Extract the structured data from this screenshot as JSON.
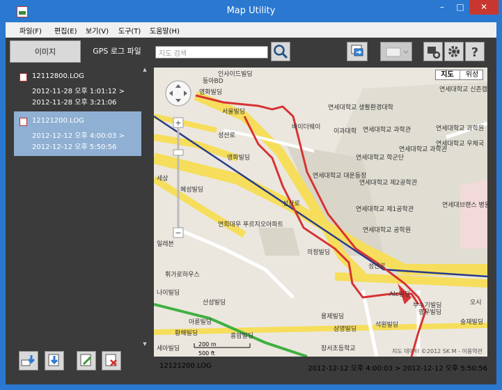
{
  "window": {
    "title": "Map Utility",
    "minimize": "–",
    "maximize": "□",
    "close": "✕"
  },
  "menu": [
    "파일(F)",
    "편집(E)",
    "보기(V)",
    "도구(T)",
    "도움말(H)"
  ],
  "tabs": {
    "images": "이미지",
    "gps": "GPS 로그 파일"
  },
  "search": {
    "placeholder": "지도 검색"
  },
  "logs": [
    {
      "name": "12112800.LOG",
      "start": "2012-11-28 오후 1:01:12 >",
      "end": "2012-11-28 오후 3:21:06"
    },
    {
      "name": "12121200.LOG",
      "start": "2012-12-12 오후 4:00:03 >",
      "end": "2012-12-12 오후 5:50:56"
    }
  ],
  "map": {
    "type_map": "지도",
    "type_satellite": "위성",
    "scale_m": "200 m",
    "scale_ft": "500 ft",
    "copyright": "지도 데이터 ©2012 SK M - 이용약관",
    "labels": {
      "l1": "인사이드빌딩",
      "l2": "동아BD",
      "l3": "영화빌딩",
      "l4": "서울빌딩",
      "l5": "바이더웨이",
      "l6": "연세대학교 생활환경대학",
      "l7": "이과대학",
      "l8": "연세대학교 과학관",
      "l9": "연세대학교 신촌캠퍼스",
      "l10": "성산로",
      "l11": "영화빌딩",
      "l12": "연세대학교 대운동장",
      "l13": "연세대학교 제2공학관",
      "l14": "연세대학교 학군단",
      "l15": "연세대학교 제1공학관",
      "l16": "연세대학교 공학원",
      "l17": "연세대학교 과학관",
      "l18": "연세대학교 우체국",
      "l19": "연세대학교 과학원",
      "l20": "연세대브랜스 병원 암센터",
      "l21": "세상",
      "l22": "혜성빌딩",
      "l23": "연희대우 푸르지오아파트",
      "l24": "일레븐",
      "l25": "성산로",
      "l26": "휘가로하우스",
      "l27": "의정빌딩",
      "l28": "성산로",
      "l29": "나이빌딩",
      "l30": "산성빌딩",
      "l31": "아륜빌딩",
      "l32": "황해빌딩",
      "l33": "흥암빌딩",
      "l34": "용제빌딩",
      "l35": "삼영빌딩",
      "l36": "석원빌딩",
      "l37": "창서초등학교",
      "l38": "세아빌딩",
      "l39": "Alc빌딩",
      "l40": "부수기빌딩",
      "l41": "영우빌딩",
      "l42": "숭재빌딩",
      "l43": "오시"
    }
  },
  "status": {
    "file": "12121200.LOG",
    "range": "2012-12-12 오후 4:00:03 > 2012-12-12 오후 5:50:56"
  },
  "colors": {
    "accent": "#2a78cf",
    "track": "#d63333",
    "road_major": "#f8e46a",
    "selected": "#8fb0d3"
  }
}
